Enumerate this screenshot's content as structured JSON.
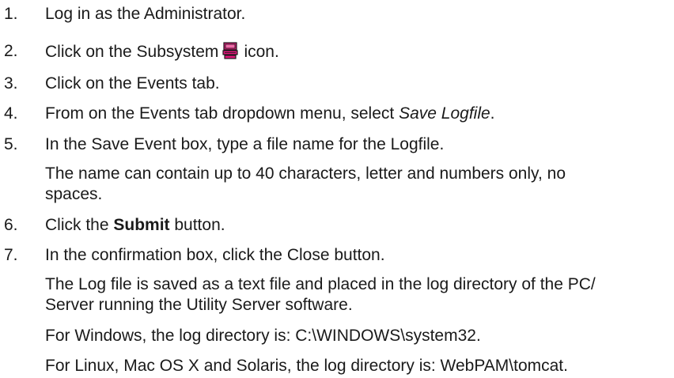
{
  "steps": [
    {
      "number": "1.",
      "text": "Log in as the Administrator."
    },
    {
      "number": "2.",
      "before": "Click on the Subsystem",
      "icon": "subsystem-icon",
      "after": "icon."
    },
    {
      "number": "3.",
      "text": "Click on the Events tab."
    },
    {
      "number": "4.",
      "before": "From on the Events tab dropdown menu, select ",
      "emphasis": "Save Logfile",
      "after": "."
    },
    {
      "number": "5.",
      "text": "In the Save Event box, type a file name for the Logfile."
    },
    {
      "number": "6.",
      "before": "Click the ",
      "bold": "Submit",
      "after": " button."
    },
    {
      "number": "7.",
      "text": "In the confirmation box, click the Close button."
    }
  ],
  "notes": {
    "step5_line1": "The name can contain up to 40 characters, letter and numbers only, no",
    "step5_line2": "spaces.",
    "step7_line1": "The Log file is saved as a text file and placed in the log directory of the PC/",
    "step7_line2": "Server running the Utility Server software.",
    "windows": "For Windows, the log directory is: C:\\WINDOWS\\system32.",
    "linux": "For Linux, Mac OS X and Solaris, the log directory is: WebPAM\\tomcat."
  },
  "colors": {
    "text": "#1a1a1a",
    "icon_primary": "#e0157a",
    "icon_dark": "#1a1a1a"
  }
}
